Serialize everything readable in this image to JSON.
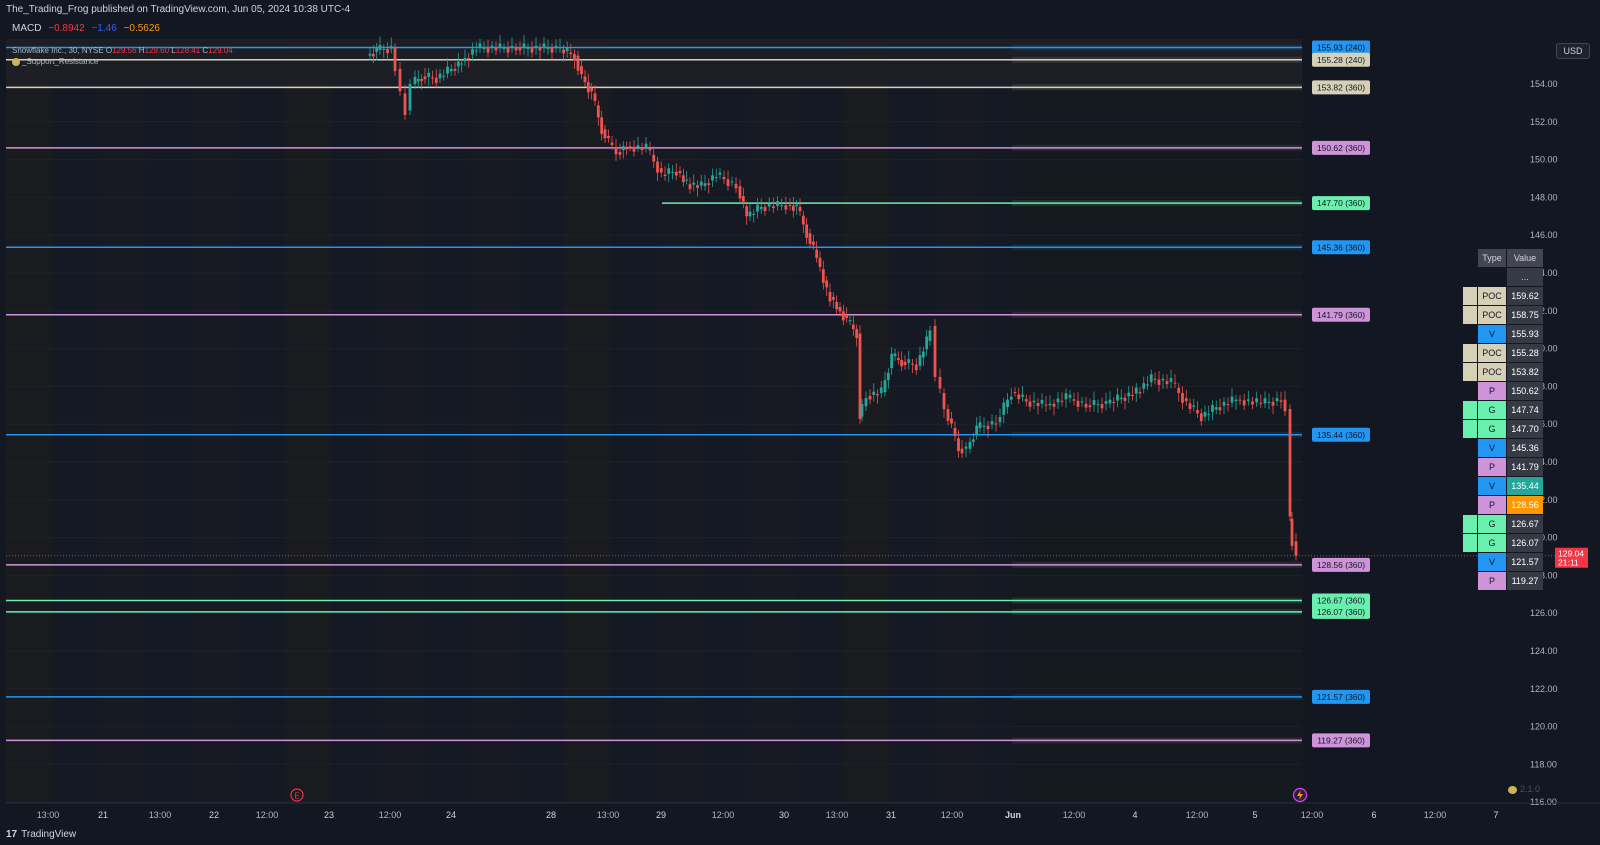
{
  "header": {
    "publisher": "The_Trading_Frog published on TradingView.com, Jun 05, 2024 10:38 UTC-4"
  },
  "macd": {
    "label": "MACD",
    "v1": "−0.8942",
    "v2": "−1.46",
    "v3": "−0.5626"
  },
  "legend": {
    "symbol": "Snowflake Inc., 30, NYSE",
    "o_label": "O",
    "o": "129.56",
    "h_label": "H",
    "h": "129.60",
    "l_label": "L",
    "l": "128.41",
    "c_label": "C",
    "c": "129.04",
    "indicator": "_Support_Resistance"
  },
  "currency_button": "USD",
  "price_axis": {
    "ticks": [
      "154.00",
      "152.00",
      "150.00",
      "148.00",
      "146.00",
      "144.00",
      "142.00",
      "140.00",
      "138.00",
      "136.00",
      "134.00",
      "132.00",
      "130.00",
      "128.00",
      "126.00",
      "124.00",
      "122.00",
      "120.00",
      "118.00",
      "116.00"
    ],
    "last_price": "129.04",
    "countdown": "21:11"
  },
  "time_axis": {
    "ticks": [
      "13:00",
      "21",
      "13:00",
      "22",
      "12:00",
      "23",
      "12:00",
      "24",
      "28",
      "13:00",
      "29",
      "12:00",
      "30",
      "13:00",
      "31",
      "12:00",
      "Jun",
      "12:00",
      "4",
      "12:00",
      "5",
      "12:00",
      "6",
      "12:00",
      "7"
    ]
  },
  "levels": [
    {
      "label": "155.93 (240)",
      "type": "V"
    },
    {
      "label": "155.28 (240)",
      "type": "POC"
    },
    {
      "label": "153.82 (360)",
      "type": "POC"
    },
    {
      "label": "150.62 (360)",
      "type": "P"
    },
    {
      "label": "147.70 (360)",
      "type": "G"
    },
    {
      "label": "145.36 (360)",
      "type": "V"
    },
    {
      "label": "141.79 (360)",
      "type": "P"
    },
    {
      "label": "135.44 (360)",
      "type": "V"
    },
    {
      "label": "128.56 (360)",
      "type": "P"
    },
    {
      "label": "126.67 (360)",
      "type": "G"
    },
    {
      "label": "126.07 (360)",
      "type": "G"
    },
    {
      "label": "121.57 (360)",
      "type": "V"
    },
    {
      "label": "119.27 (360)",
      "type": "P"
    }
  ],
  "colors": {
    "V": "#2196f3",
    "POC": "#d6d1b6",
    "P": "#ce93d8",
    "G": "#69f0ae",
    "up": "#26a69a",
    "down": "#ef5350",
    "highlight": "#ff9800",
    "teal": "#26a69a"
  },
  "table": {
    "header_type": "Type",
    "header_value": "Value",
    "dots": "...",
    "rows": [
      {
        "type": "POC",
        "value": "159.62"
      },
      {
        "type": "POC",
        "value": "158.75"
      },
      {
        "type": "V",
        "value": "155.93"
      },
      {
        "type": "POC",
        "value": "155.28"
      },
      {
        "type": "POC",
        "value": "153.82"
      },
      {
        "type": "P",
        "value": "150.62"
      },
      {
        "type": "G",
        "value": "147.74"
      },
      {
        "type": "G",
        "value": "147.70"
      },
      {
        "type": "V",
        "value": "145.36"
      },
      {
        "type": "P",
        "value": "141.79"
      },
      {
        "type": "V",
        "value": "135.44",
        "bg": "teal"
      },
      {
        "type": "P",
        "value": "128.56",
        "bg": "highlight"
      },
      {
        "type": "G",
        "value": "126.67"
      },
      {
        "type": "G",
        "value": "126.07"
      },
      {
        "type": "V",
        "value": "121.57"
      },
      {
        "type": "P",
        "value": "119.27"
      }
    ]
  },
  "markers": {
    "earnings_icon": "E",
    "flash_icon": "flash-icon"
  },
  "version": "2.1.0",
  "footer": {
    "logo": "TradingView"
  }
}
